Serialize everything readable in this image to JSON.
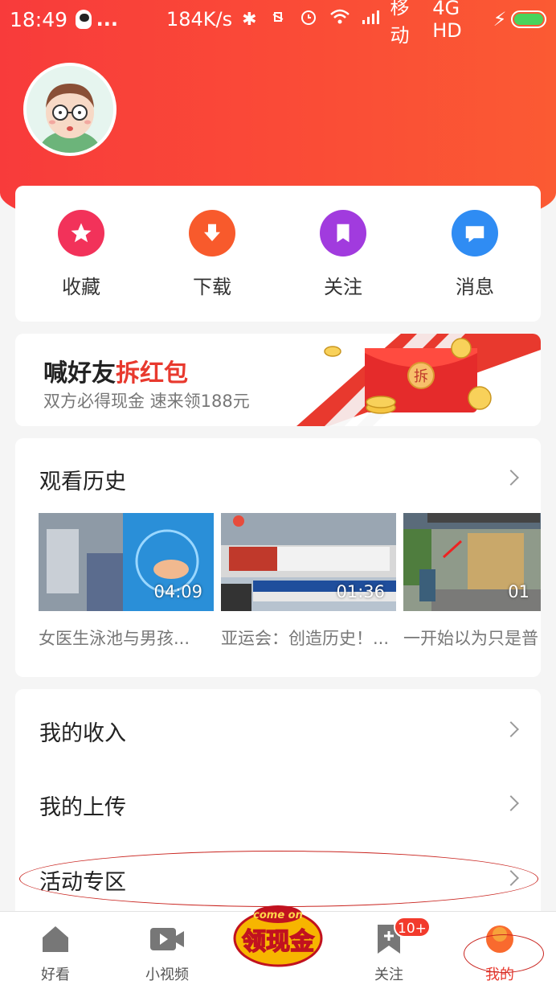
{
  "status_bar": {
    "time": "18:49",
    "dots": "...",
    "speed": "184K/s",
    "carrier": "移动",
    "network": "4G HD"
  },
  "quick_actions": [
    {
      "label": "收藏",
      "icon": "star-icon",
      "color": "#f2325a"
    },
    {
      "label": "下载",
      "icon": "download-icon",
      "color": "#f85a2c"
    },
    {
      "label": "关注",
      "icon": "bookmark-icon",
      "color": "#a13bde"
    },
    {
      "label": "消息",
      "icon": "message-icon",
      "color": "#2f8cf3"
    }
  ],
  "banner": {
    "title_main": "喊好友",
    "title_highlight": "拆红包",
    "subtitle": "双方必得现金 速来领188元",
    "envelope_text": "拆"
  },
  "history": {
    "title": "观看历史",
    "videos": [
      {
        "duration": "04:09",
        "title": "女医生泳池与男孩..."
      },
      {
        "duration": "01:36",
        "title": "亚运会：创造历史！..."
      },
      {
        "duration": "01",
        "title": "一开始以为只是普"
      }
    ]
  },
  "menu": {
    "items": [
      {
        "label": "我的收入"
      },
      {
        "label": "我的上传"
      },
      {
        "label": "活动专区"
      }
    ]
  },
  "tabbar": {
    "tabs": [
      {
        "label": "好看"
      },
      {
        "label": "小视频"
      },
      {
        "label": "关注"
      },
      {
        "label": "我的"
      }
    ],
    "promo_top": "come on",
    "promo_main": "领现金",
    "badge": "10+"
  },
  "colors": {
    "accent": "#e8392e",
    "header_start": "#f83b3b",
    "header_end": "#fb5a33"
  }
}
